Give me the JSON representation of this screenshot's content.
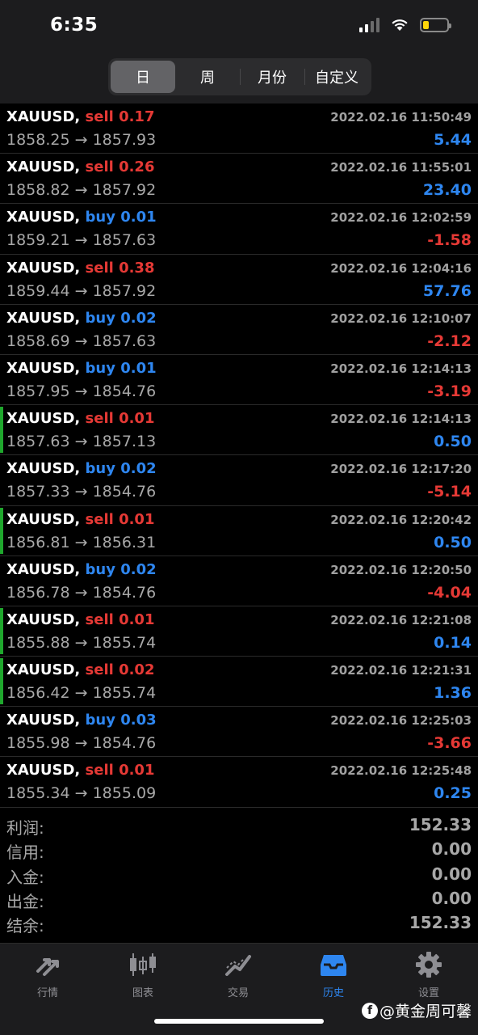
{
  "status_bar": {
    "time": "6:35"
  },
  "segment": {
    "items": [
      "日",
      "周",
      "月份",
      "自定义"
    ],
    "active_index": 0
  },
  "trades": [
    {
      "symbol": "XAUUSD,",
      "side": "sell",
      "volume": "0.17",
      "datetime": "2022.02.16 11:50:49",
      "open": "1858.25",
      "close": "1857.93",
      "profit": "5.44",
      "marked": false
    },
    {
      "symbol": "XAUUSD,",
      "side": "sell",
      "volume": "0.26",
      "datetime": "2022.02.16 11:55:01",
      "open": "1858.82",
      "close": "1857.92",
      "profit": "23.40",
      "marked": false
    },
    {
      "symbol": "XAUUSD,",
      "side": "buy",
      "volume": "0.01",
      "datetime": "2022.02.16 12:02:59",
      "open": "1859.21",
      "close": "1857.63",
      "profit": "-1.58",
      "marked": false
    },
    {
      "symbol": "XAUUSD,",
      "side": "sell",
      "volume": "0.38",
      "datetime": "2022.02.16 12:04:16",
      "open": "1859.44",
      "close": "1857.92",
      "profit": "57.76",
      "marked": false
    },
    {
      "symbol": "XAUUSD,",
      "side": "buy",
      "volume": "0.02",
      "datetime": "2022.02.16 12:10:07",
      "open": "1858.69",
      "close": "1857.63",
      "profit": "-2.12",
      "marked": false
    },
    {
      "symbol": "XAUUSD,",
      "side": "buy",
      "volume": "0.01",
      "datetime": "2022.02.16 12:14:13",
      "open": "1857.95",
      "close": "1854.76",
      "profit": "-3.19",
      "marked": false
    },
    {
      "symbol": "XAUUSD,",
      "side": "sell",
      "volume": "0.01",
      "datetime": "2022.02.16 12:14:13",
      "open": "1857.63",
      "close": "1857.13",
      "profit": "0.50",
      "marked": true
    },
    {
      "symbol": "XAUUSD,",
      "side": "buy",
      "volume": "0.02",
      "datetime": "2022.02.16 12:17:20",
      "open": "1857.33",
      "close": "1854.76",
      "profit": "-5.14",
      "marked": false
    },
    {
      "symbol": "XAUUSD,",
      "side": "sell",
      "volume": "0.01",
      "datetime": "2022.02.16 12:20:42",
      "open": "1856.81",
      "close": "1856.31",
      "profit": "0.50",
      "marked": true
    },
    {
      "symbol": "XAUUSD,",
      "side": "buy",
      "volume": "0.02",
      "datetime": "2022.02.16 12:20:50",
      "open": "1856.78",
      "close": "1854.76",
      "profit": "-4.04",
      "marked": false
    },
    {
      "symbol": "XAUUSD,",
      "side": "sell",
      "volume": "0.01",
      "datetime": "2022.02.16 12:21:08",
      "open": "1855.88",
      "close": "1855.74",
      "profit": "0.14",
      "marked": true
    },
    {
      "symbol": "XAUUSD,",
      "side": "sell",
      "volume": "0.02",
      "datetime": "2022.02.16 12:21:31",
      "open": "1856.42",
      "close": "1855.74",
      "profit": "1.36",
      "marked": true
    },
    {
      "symbol": "XAUUSD,",
      "side": "buy",
      "volume": "0.03",
      "datetime": "2022.02.16 12:25:03",
      "open": "1855.98",
      "close": "1854.76",
      "profit": "-3.66",
      "marked": false
    },
    {
      "symbol": "XAUUSD,",
      "side": "sell",
      "volume": "0.01",
      "datetime": "2022.02.16 12:25:48",
      "open": "1855.34",
      "close": "1855.09",
      "profit": "0.25",
      "marked": false
    }
  ],
  "arrow": "→",
  "summary": [
    {
      "label": "利润:",
      "value": "152.33"
    },
    {
      "label": "信用:",
      "value": "0.00"
    },
    {
      "label": "入金:",
      "value": "0.00"
    },
    {
      "label": "出金:",
      "value": "0.00"
    },
    {
      "label": "结余:",
      "value": "152.33"
    }
  ],
  "tabbar": [
    {
      "label": "行情",
      "icon": "quotes-arrows-icon",
      "active": false
    },
    {
      "label": "图表",
      "icon": "candlestick-chart-icon",
      "active": false
    },
    {
      "label": "交易",
      "icon": "trade-chart-icon",
      "active": false
    },
    {
      "label": "历史",
      "icon": "history-tray-icon",
      "active": true
    },
    {
      "label": "设置",
      "icon": "gear-icon",
      "active": false
    }
  ],
  "watermark": "@黄金周可馨",
  "colors": {
    "sell": "#e53935",
    "buy": "#2e86f0",
    "marker": "#1fa72d",
    "active_tab": "#2e86f0"
  }
}
